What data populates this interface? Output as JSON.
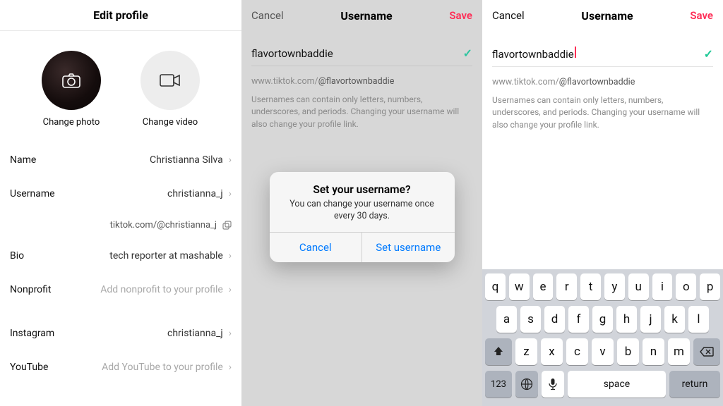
{
  "panel1": {
    "title": "Edit profile",
    "change_photo": "Change photo",
    "change_video": "Change video",
    "rows": {
      "name": {
        "label": "Name",
        "value": "Christianna Silva"
      },
      "username": {
        "label": "Username",
        "value": "christianna_j"
      },
      "link": {
        "value": "tiktok.com/@christianna_j"
      },
      "bio": {
        "label": "Bio",
        "value": "tech reporter at mashable"
      },
      "nonprofit": {
        "label": "Nonprofit",
        "placeholder": "Add nonprofit to your profile"
      },
      "instagram": {
        "label": "Instagram",
        "value": "christianna_j"
      },
      "youtube": {
        "label": "YouTube",
        "placeholder": "Add YouTube to your profile"
      }
    }
  },
  "panel2": {
    "header": {
      "cancel": "Cancel",
      "title": "Username",
      "save": "Save"
    },
    "input": "flavortownbaddie",
    "url_prefix": "www.tiktok.com/",
    "url_handle": "@flavortownbaddie",
    "help": "Usernames can contain only letters, numbers, underscores, and periods. Changing your username will also change your profile link.",
    "dialog": {
      "title": "Set your username?",
      "msg": "You can change your username once every 30 days.",
      "cancel": "Cancel",
      "confirm": "Set username"
    }
  },
  "panel3": {
    "header": {
      "cancel": "Cancel",
      "title": "Username",
      "save": "Save"
    },
    "input": "flavortownbaddie",
    "url_prefix": "www.tiktok.com/",
    "url_handle": "@flavortownbaddie",
    "help": "Usernames can contain only letters, numbers, underscores, and periods. Changing your username will also change your profile link.",
    "keyboard": {
      "row1": [
        "q",
        "w",
        "e",
        "r",
        "t",
        "y",
        "u",
        "i",
        "o",
        "p"
      ],
      "row2": [
        "a",
        "s",
        "d",
        "f",
        "g",
        "h",
        "j",
        "k",
        "l"
      ],
      "row3": [
        "z",
        "x",
        "c",
        "v",
        "b",
        "n",
        "m"
      ],
      "numbers": "123",
      "space": "space",
      "return": "return"
    }
  }
}
